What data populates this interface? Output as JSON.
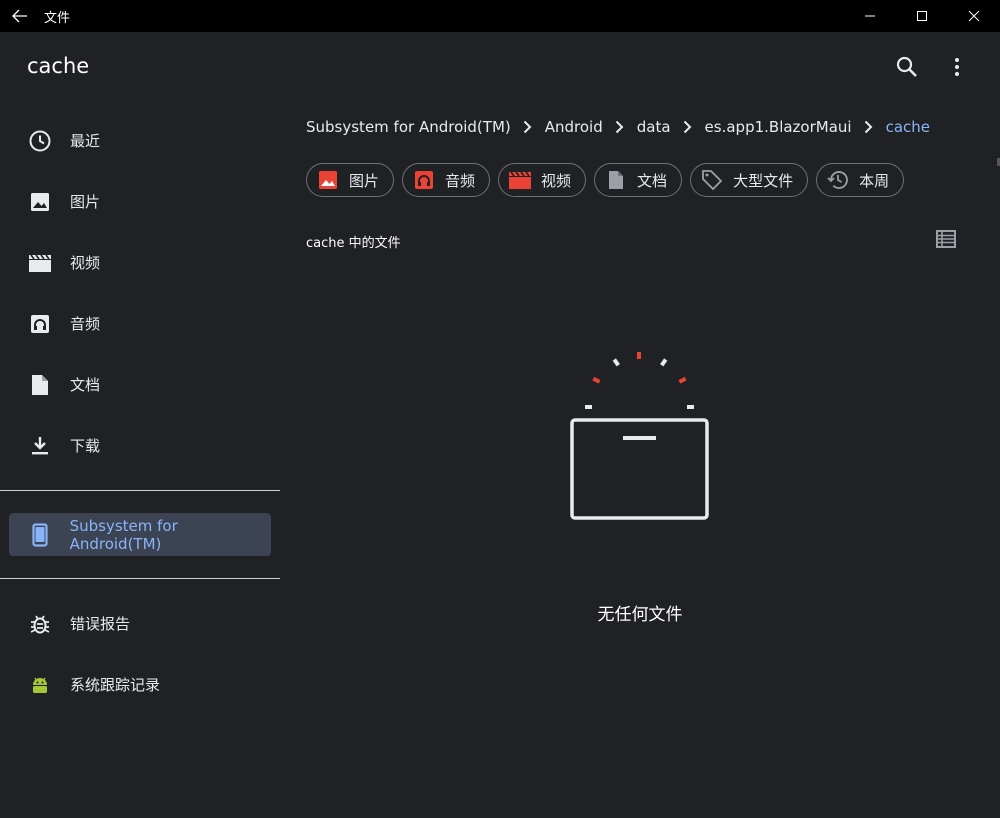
{
  "window": {
    "title": "文件"
  },
  "appbar": {
    "title": "cache",
    "search_icon": "search-icon",
    "more_icon": "more-vert-icon"
  },
  "sidebar": {
    "items": [
      {
        "label": "最近",
        "icon": "clock-icon"
      },
      {
        "label": "图片",
        "icon": "image-icon"
      },
      {
        "label": "视频",
        "icon": "video-icon"
      },
      {
        "label": "音频",
        "icon": "audio-icon"
      },
      {
        "label": "文档",
        "icon": "document-icon"
      },
      {
        "label": "下载",
        "icon": "download-icon"
      }
    ],
    "active": {
      "label": "Subsystem for Android(TM)",
      "icon": "phone-icon"
    },
    "bottom": [
      {
        "label": "错误报告",
        "icon": "bug-icon"
      },
      {
        "label": "系统跟踪记录",
        "icon": "android-icon"
      }
    ]
  },
  "breadcrumb": {
    "items": [
      "Subsystem for Android(TM)",
      "Android",
      "data",
      "es.app1.BlazorMaui"
    ],
    "current": "cache"
  },
  "chips": [
    {
      "label": "图片",
      "icon": "image-icon"
    },
    {
      "label": "音频",
      "icon": "audio-icon"
    },
    {
      "label": "视频",
      "icon": "video-icon"
    },
    {
      "label": "文档",
      "icon": "document-icon"
    },
    {
      "label": "大型文件",
      "icon": "tag-icon"
    },
    {
      "label": "本周",
      "icon": "history-icon"
    }
  ],
  "content": {
    "section_title": "cache 中的文件",
    "empty_text": "无任何文件"
  },
  "colors": {
    "accent": "#8ab4f8",
    "red": "#ea4335",
    "android_green": "#a4c639",
    "background": "#202124"
  }
}
